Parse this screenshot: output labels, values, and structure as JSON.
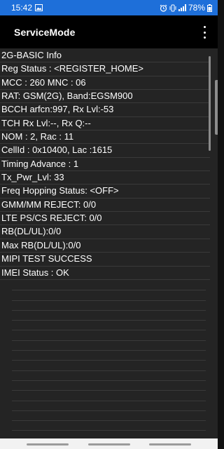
{
  "status_bar": {
    "time": "15:42",
    "battery": "78%",
    "left_icons": [
      "image-icon"
    ],
    "right_icons": [
      "alarm-icon",
      "vibrate-icon",
      "signal-icon",
      "battery-icon"
    ]
  },
  "app_bar": {
    "title": "ServiceMode",
    "menu_icon": "overflow-menu-icon"
  },
  "rows": [
    "2G-BASIC Info",
    "Reg Status : <REGISTER_HOME>",
    "MCC : 260 MNC : 06",
    "RAT: GSM(2G), Band:EGSM900",
    "BCCH arfcn:997, Rx Lvl:-53",
    "TCH Rx Lvl:--, Rx Q:--",
    "NOM : 2, Rac : 11",
    "CellId : 0x10400, Lac :1615",
    "Timing Advance : 1",
    "Tx_Pwr_Lvl: 33",
    "Freq Hopping Status: <OFF>",
    "GMM/MM REJECT: 0/0",
    "LTE PS/CS REJECT: 0/0",
    "RB(DL/UL):0/0",
    "Max RB(DL/UL):0/0",
    "MIPI TEST SUCCESS",
    "IMEI Status : OK"
  ],
  "colors": {
    "status_bar": "#1e6fd9",
    "app_bar": "#000000",
    "content_bg": "#242424",
    "text": "#ffffff",
    "nav_bar": "#f2f2f2"
  }
}
